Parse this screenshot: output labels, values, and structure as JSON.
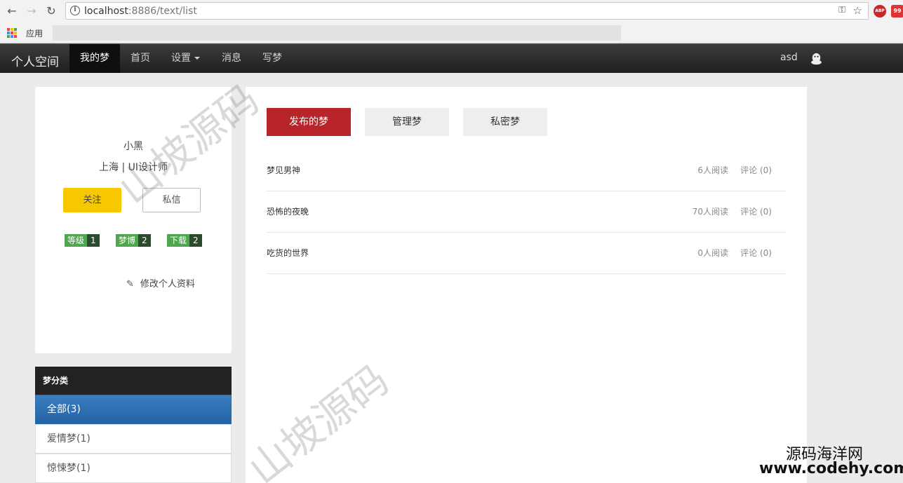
{
  "browser": {
    "url_host": "localhost",
    "url_rest": ":8886/text/list",
    "bookmarks_apps_label": "应用",
    "ext_abp": "ABP",
    "ext_badge": "99"
  },
  "navbar": {
    "brand": "个人空间",
    "items": [
      {
        "label": "我的梦",
        "active": true
      },
      {
        "label": "首页",
        "active": false
      },
      {
        "label": "设置",
        "active": false
      },
      {
        "label": "消息",
        "active": false
      },
      {
        "label": "写梦",
        "active": false
      }
    ],
    "user": "asd"
  },
  "profile": {
    "name": "小黑",
    "location": "上海 | UI设计师",
    "follow_label": "关注",
    "message_label": "私信",
    "badges": [
      {
        "label": "等级",
        "value": "1"
      },
      {
        "label": "梦博",
        "value": "2"
      },
      {
        "label": "下载",
        "value": "2"
      }
    ],
    "edit_label": "修改个人资料"
  },
  "categories": {
    "title": "梦分类",
    "items": [
      {
        "label": "全部(3)",
        "active": true
      },
      {
        "label": "爱情梦(1)",
        "active": false
      },
      {
        "label": "惊悚梦(1)",
        "active": false
      }
    ]
  },
  "main": {
    "tabs": [
      {
        "label": "发布的梦",
        "active": true
      },
      {
        "label": "管理梦",
        "active": false
      },
      {
        "label": "私密梦",
        "active": false
      }
    ],
    "posts": [
      {
        "title": "梦见男神",
        "reads": "6人阅读",
        "comments": "评论 (0)"
      },
      {
        "title": "恐怖的夜晚",
        "reads": "70人阅读",
        "comments": "评论 (0)"
      },
      {
        "title": "吃货的世界",
        "reads": "0人阅读",
        "comments": "评论 (0)"
      }
    ]
  },
  "watermark": {
    "text": "山坡源码",
    "site_name": "源码海洋网",
    "site_url": "www.codehy.com"
  },
  "colors": {
    "brand_red": "#b8242a",
    "follow_yellow": "#f7c800",
    "category_active": "#2462a6",
    "badge_green": "#4ea64e"
  }
}
